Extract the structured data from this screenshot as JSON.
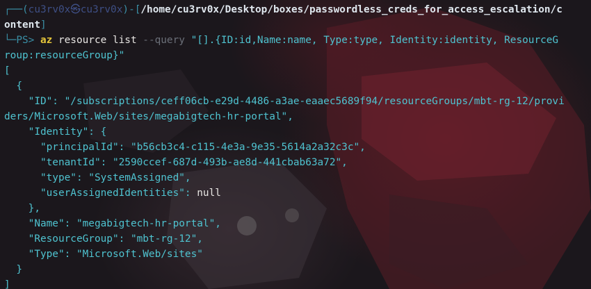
{
  "prompt": {
    "corner_top": "┌──",
    "user_open": "(",
    "user": "cu3rv0x",
    "at_symbol": "㉿",
    "host": "cu3rv0x",
    "user_close": ")",
    "sep_open": "-[",
    "cwd_line1": "/home/cu3rv0x/Desktop/boxes/passwordless_creds_for_access_escalation/c",
    "cwd_line2": "ontent",
    "sep_close": "]",
    "corner_bottom": "└─",
    "ps": "PS> ",
    "cmd": "az",
    "args": " resource list ",
    "flag": "--query",
    "query_line1": " \"[].{ID:id,Name:name, Type:type, Identity:identity, ResourceG",
    "query_line2": "roup:resourceGroup}\""
  },
  "output": {
    "open_bracket": "[",
    "open_brace": "  {",
    "id_line1": "    \"ID\": \"/subscriptions/ceff06cb-e29d-4486-a3ae-eaaec5689f94/resourceGroups/mbt-rg-12/provi",
    "id_line2": "ders/Microsoft.Web/sites/megabigtech-hr-portal\",",
    "identity_open": "    \"Identity\": {",
    "principal_id": "      \"principalId\": \"b56cb3c4-c115-4e3a-9e35-5614a2a32c3c\",",
    "tenant_id": "      \"tenantId\": \"2590ccef-687d-493b-ae8d-441cbab63a72\",",
    "type_inner": "      \"type\": \"SystemAssigned\",",
    "uai_key": "      \"userAssignedIdentities\": ",
    "uai_val": "null",
    "identity_close": "    },",
    "name": "    \"Name\": \"megabigtech-hr-portal\",",
    "resource_group": "    \"ResourceGroup\": \"mbt-rg-12\",",
    "type_outer": "    \"Type\": \"Microsoft.Web/sites\"",
    "close_brace": "  }",
    "close_bracket": "]"
  },
  "colors": {
    "accent_cyan": "#4fc3d0",
    "prompt_teal": "#3a8fa6",
    "command_yellow": "#e5c53a",
    "background": "#1b171c"
  }
}
